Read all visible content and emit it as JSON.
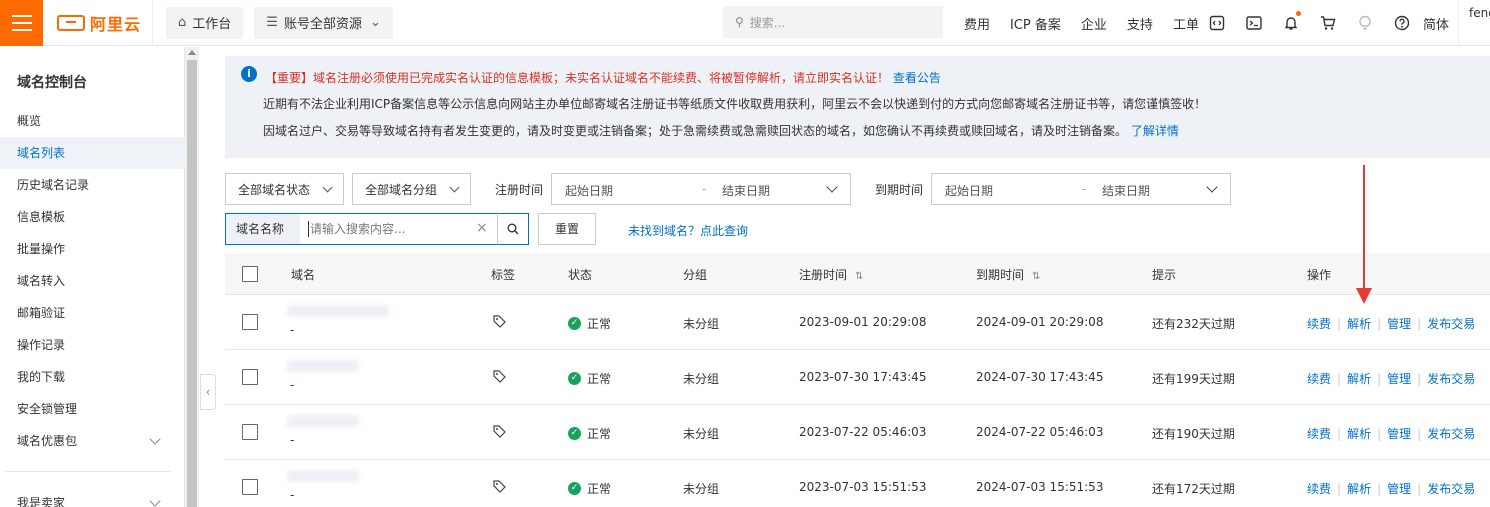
{
  "topbar": {
    "logo": "阿里云",
    "workbench": "工作台",
    "resources": "账号全部资源",
    "search_placeholder": "搜索...",
    "links": [
      "费用",
      "ICP 备案",
      "企业",
      "支持",
      "工单"
    ],
    "lang": "简体",
    "user": "feng"
  },
  "sidebar": {
    "title": "域名控制台",
    "items": [
      {
        "label": "概览"
      },
      {
        "label": "域名列表"
      },
      {
        "label": "历史域名记录"
      },
      {
        "label": "信息模板"
      },
      {
        "label": "批量操作"
      },
      {
        "label": "域名转入"
      },
      {
        "label": "邮箱验证"
      },
      {
        "label": "操作记录"
      },
      {
        "label": "我的下载"
      },
      {
        "label": "安全锁管理"
      },
      {
        "label": "域名优惠包"
      },
      {
        "label": "我是卖家"
      }
    ],
    "active_index": 1
  },
  "notice": {
    "line1": "【重要】域名注册必须使用已完成实名认证的信息模板；未实名认证域名不能续费、将被暂停解析，请立即实名认证！",
    "line1_link": "查看公告",
    "line2": "近期有不法企业利用ICP备案信息等公示信息向网站主办单位邮寄域名注册证书等纸质文件收取费用获利，阿里云不会以快递到付的方式向您邮寄域名注册证书等，请您谨慎签收！",
    "line3": "因域名过户、交易等导致域名持有者发生变更的，请及时变更或注销备案；处于急需续费或急需赎回状态的域名，如您确认不再续费或赎回域名，请及时注销备案。",
    "line3_link": "了解详情"
  },
  "filters": {
    "status": "全部域名状态",
    "group": "全部域名分组",
    "reg_label": "注册时间",
    "exp_label": "到期时间",
    "start_date": "起始日期",
    "end_date": "结束日期",
    "separator": "-",
    "search_prefix": "域名名称",
    "search_placeholder": "请输入搜索内容...",
    "reset": "重置",
    "not_found": "未找到域名？点此查询"
  },
  "table": {
    "headers": {
      "domain": "域名",
      "tag": "标签",
      "status": "状态",
      "group": "分组",
      "reg_time": "注册时间",
      "exp_time": "到期时间",
      "hint": "提示",
      "ops": "操作"
    },
    "rows": [
      {
        "sub": "-",
        "status": "正常",
        "group": "未分组",
        "reg": "2023-09-01 20:29:08",
        "exp": "2024-09-01 20:29:08",
        "hint": "还有232天过期"
      },
      {
        "sub": "-",
        "status": "正常",
        "group": "未分组",
        "reg": "2023-07-30 17:43:45",
        "exp": "2024-07-30 17:43:45",
        "hint": "还有199天过期"
      },
      {
        "sub": "-",
        "status": "正常",
        "group": "未分组",
        "reg": "2023-07-22 05:46:03",
        "exp": "2024-07-22 05:46:03",
        "hint": "还有190天过期"
      },
      {
        "sub": "-",
        "status": "正常",
        "group": "未分组",
        "reg": "2023-07-03 15:51:53",
        "exp": "2024-07-03 15:51:53",
        "hint": "还有172天过期"
      }
    ],
    "ops": [
      "续费",
      "解析",
      "管理",
      "发布交易"
    ]
  },
  "colors": {
    "brand": "#ff6a00",
    "link": "#0070cc",
    "warning": "#d93026",
    "success": "#19a15f",
    "annotation_arrow": "#e53935"
  }
}
